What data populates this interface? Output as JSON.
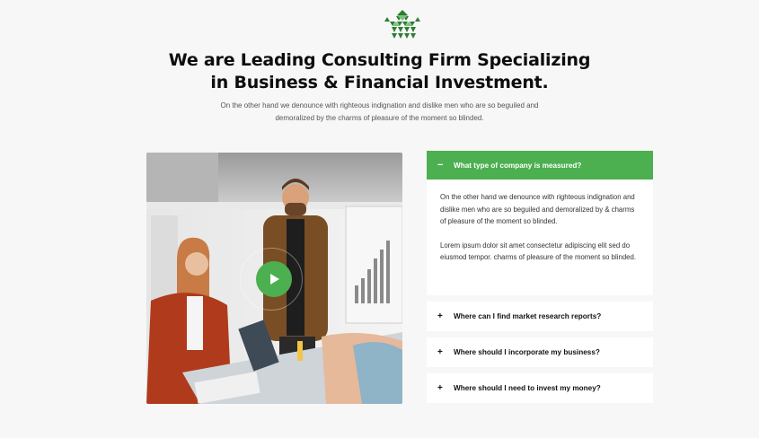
{
  "brand": {
    "logo_icon": "house-triangle-logo-icon",
    "logo_color": "#2e7d32"
  },
  "hero": {
    "title_line1": "We are Leading Consulting Firm Specializing",
    "title_line2": "in Business & Financial Investment.",
    "subtitle_line1": "On the other hand we denounce with righteous indignation and dislike men who are so beguiled and",
    "subtitle_line2": "demoralized by the charms of pleasure of the moment so blinded."
  },
  "video": {
    "play_icon": "play-icon",
    "accent": "#4caf50"
  },
  "faq": {
    "accent": "#4caf50",
    "active": {
      "sign": "−",
      "question": "What type of company is measured?",
      "answer_p1": "On the other hand we denounce with righteous indignation and dislike men who are so beguiled and demoralized by & charms of pleasure of the moment so blinded.",
      "answer_p2": "Lorem ipsum dolor sit amet consectetur adipiscing elit sed do eiusmod tempor. charms of pleasure of the moment so blinded."
    },
    "items": [
      {
        "sign": "+",
        "question": "Where can I find market research reports?"
      },
      {
        "sign": "+",
        "question": "Where should I incorporate my business?"
      },
      {
        "sign": "+",
        "question": "Where should I need to invest my money?"
      }
    ]
  }
}
